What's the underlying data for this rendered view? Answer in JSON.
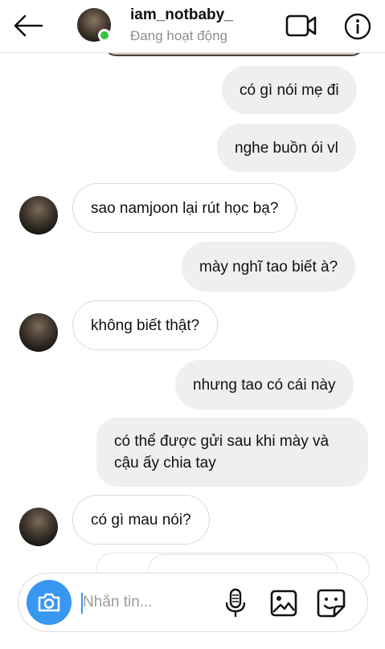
{
  "header": {
    "username": "iam_notbaby_",
    "status": "Đang hoạt động"
  },
  "messages": [
    {
      "side": "out",
      "text": "có gì nói mẹ đi"
    },
    {
      "side": "out",
      "text": "nghe buồn ói vl"
    },
    {
      "side": "in",
      "text": "sao namjoon lại rút học bạ?"
    },
    {
      "side": "out",
      "text": "mày nghĩ tao biết à?"
    },
    {
      "side": "in",
      "text": "không biết thật?"
    },
    {
      "side": "out",
      "text": "nhưng tao có cái này"
    },
    {
      "side": "out",
      "text": "có thể được gửi sau khi mày và cậu ấy chia tay"
    },
    {
      "side": "in",
      "text": "có gì mau nói?"
    }
  ],
  "composer": {
    "placeholder": "Nhắn tin..."
  },
  "icons": {
    "back": "arrow-left-icon",
    "video": "video-camera-icon",
    "info": "info-icon",
    "camera": "camera-icon",
    "mic": "microphone-icon",
    "gallery": "image-gallery-icon",
    "sticker": "sticker-icon"
  },
  "colors": {
    "accent": "#3897f0",
    "online": "#35c33d",
    "outgoing_bubble": "#efefef",
    "incoming_border": "#dbdbdb",
    "status_text": "#8e8e8e"
  }
}
